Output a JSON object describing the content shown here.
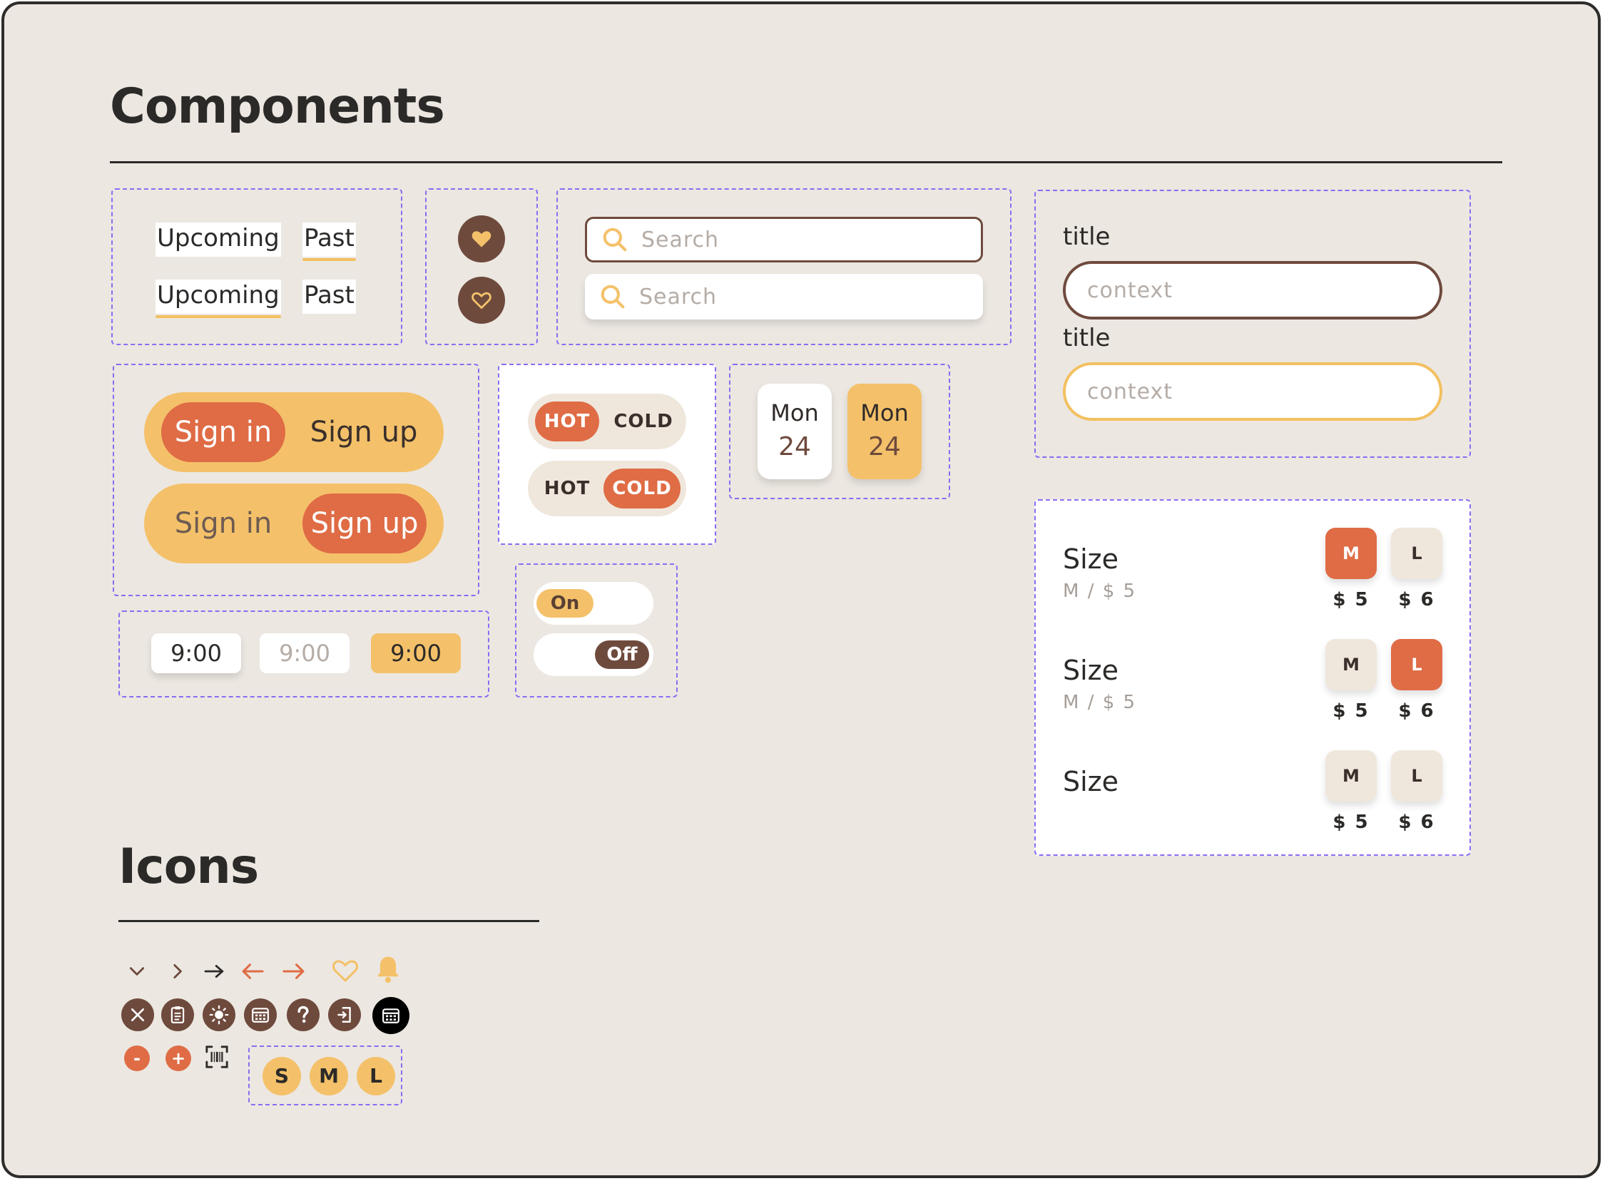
{
  "sections": {
    "components_title": "Components",
    "icons_title": "Icons"
  },
  "tabs": {
    "row1": [
      "Upcoming",
      "Past"
    ],
    "row2": [
      "Upcoming",
      "Past"
    ],
    "active_row1": "Past",
    "active_row2": "Upcoming"
  },
  "favorite": {
    "filled_icon": "heart-filled-icon",
    "outline_icon": "heart-outline-icon"
  },
  "search": {
    "placeholder_1": "Search",
    "placeholder_2": "Search"
  },
  "form": {
    "label_1": "title",
    "value_1": "context",
    "label_2": "title",
    "value_2": "context"
  },
  "auth": {
    "sign_in": "Sign in",
    "sign_up": "Sign up",
    "selected_row1": "Sign in",
    "selected_row2": "Sign up"
  },
  "temp": {
    "hot": "HOT",
    "cold": "COLD",
    "selected_row1": "HOT",
    "selected_row2": "COLD"
  },
  "dates": [
    {
      "day": "Mon",
      "num": "24",
      "selected": false
    },
    {
      "day": "Mon",
      "num": "24",
      "selected": true
    }
  ],
  "times": [
    "9:00",
    "9:00",
    "9:00"
  ],
  "toggles": {
    "on": "On",
    "off": "Off"
  },
  "size": {
    "rows": [
      {
        "label": "Size",
        "sub": "M / $ 5",
        "selected": "M"
      },
      {
        "label": "Size",
        "sub": "M / $ 5",
        "selected": "L"
      },
      {
        "label": "Size",
        "sub": "",
        "selected": ""
      }
    ],
    "options": [
      "M",
      "L"
    ],
    "prices": [
      "$ 5",
      "$ 6"
    ]
  },
  "icons": {
    "row1": [
      "chevron-down-icon",
      "chevron-right-icon",
      "arrow-right-icon",
      "arrow-left-icon",
      "arrow-right-icon",
      "heart-outline-icon",
      "bell-icon"
    ],
    "row2": [
      "close-icon",
      "clipboard-icon",
      "sun-icon",
      "calendar-icon",
      "help-icon",
      "logout-icon",
      "calendar-icon"
    ],
    "minus": "-",
    "plus": "+",
    "sml": [
      "S",
      "M",
      "L"
    ]
  },
  "colors": {
    "accent_orange": "#df6c45",
    "accent_yellow": "#f4c16a",
    "brown": "#6e4a3d",
    "background": "#ece7e1",
    "dashed_outline": "#8b6cf2"
  }
}
